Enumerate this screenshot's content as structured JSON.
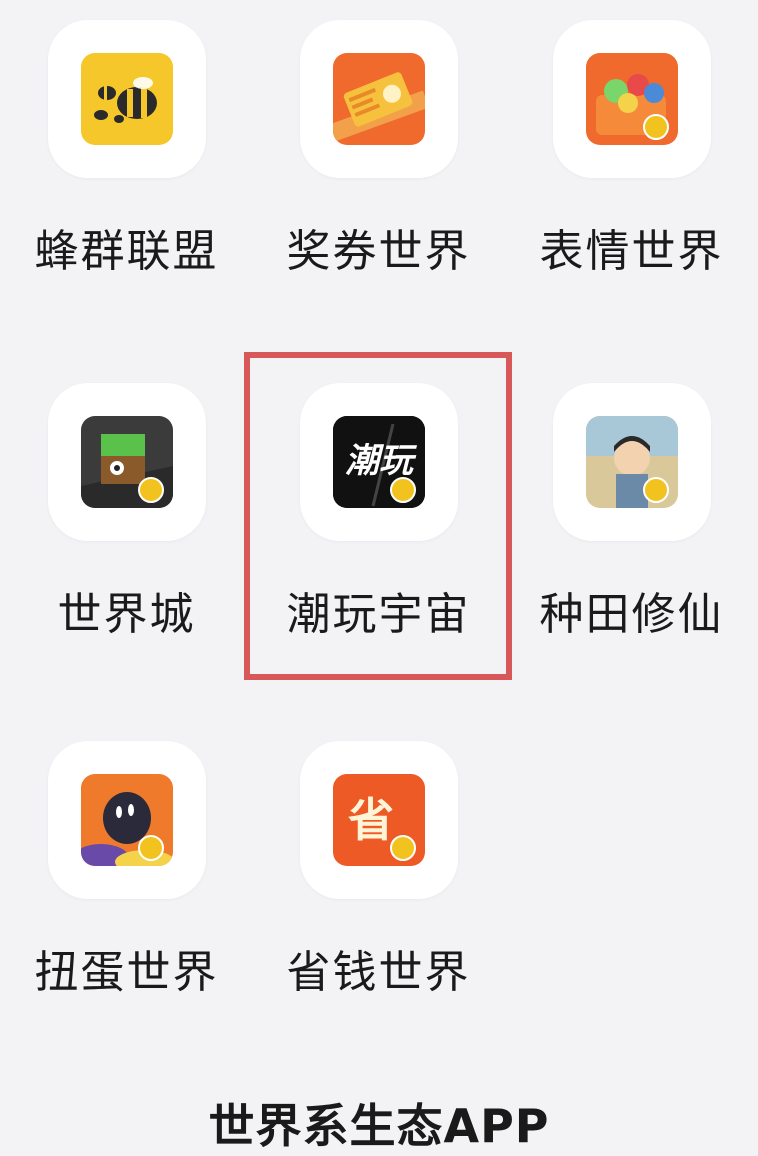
{
  "apps": [
    {
      "label": "蜂群联盟",
      "icon": "bee-swarm-icon",
      "color": "#f5c72a"
    },
    {
      "label": "奖券世界",
      "icon": "lottery-ticket-icon",
      "color": "#ef6a2c"
    },
    {
      "label": "表情世界",
      "icon": "emoji-basket-icon",
      "color": "#ef6a2c"
    },
    {
      "label": "世界城",
      "icon": "block-city-icon",
      "color": "#3b3b3b"
    },
    {
      "label": "潮玩宇宙",
      "icon": "chaowan-logo-icon",
      "logo_text": "潮玩",
      "color": "#111111"
    },
    {
      "label": "种田修仙",
      "icon": "farming-character-icon",
      "color": "#c9a060"
    },
    {
      "label": "扭蛋世界",
      "icon": "capsule-creature-icon",
      "color": "#ef7a2c"
    },
    {
      "label": "省钱世界",
      "icon": "save-money-icon",
      "logo_text": "省",
      "color": "#ee5a26"
    }
  ],
  "highlight_color": "#d8585a",
  "footer": "世界系生态APP"
}
